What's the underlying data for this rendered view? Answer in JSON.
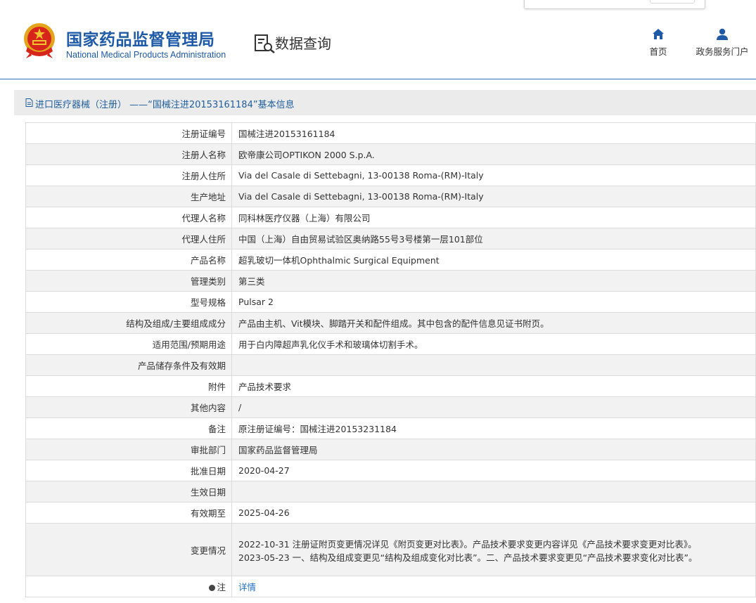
{
  "header": {
    "agency_name_cn": "国家药品监督管理局",
    "agency_name_en": "National Medical Products Administration",
    "query_title": "数据查询",
    "nav": {
      "home_label": "首页",
      "portal_label": "政务服务门户"
    }
  },
  "title_bar": {
    "text": "进口医疗器械（注册） ——“国械注进20153161184”基本信息"
  },
  "table": {
    "rows": [
      {
        "label": "注册证编号",
        "value": "国械注进20153161184"
      },
      {
        "label": "注册人名称",
        "value": "欧帝康公司OPTIKON 2000 S.p.A."
      },
      {
        "label": "注册人住所",
        "value": "Via del Casale di Settebagni, 13-00138 Roma-(RM)-Italy"
      },
      {
        "label": "生产地址",
        "value": "Via del Casale di Settebagni, 13-00138 Roma-(RM)-Italy"
      },
      {
        "label": "代理人名称",
        "value": "同科林医疗仪器（上海）有限公司"
      },
      {
        "label": "代理人住所",
        "value": "中国（上海）自由贸易试验区奥纳路55号3号楼第一层101部位"
      },
      {
        "label": "产品名称",
        "value": "超乳玻切一体机Ophthalmic Surgical Equipment"
      },
      {
        "label": "管理类别",
        "value": "第三类"
      },
      {
        "label": "型号规格",
        "value": "Pulsar 2"
      },
      {
        "label": "结构及组成/主要组成成分",
        "value": "产品由主机、Vit模块、脚踏开关和配件组成。其中包含的配件信息见证书附页。"
      },
      {
        "label": "适用范围/预期用途",
        "value": "用于白内障超声乳化仪手术和玻璃体切割手术。"
      },
      {
        "label": "产品储存条件及有效期",
        "value": ""
      },
      {
        "label": "附件",
        "value": "产品技术要求"
      },
      {
        "label": "其他内容",
        "value": "/"
      },
      {
        "label": "备注",
        "value": "原注册证编号：国械注进20153231184"
      },
      {
        "label": "审批部门",
        "value": "国家药品监督管理局"
      },
      {
        "label": "批准日期",
        "value": "2020-04-27"
      },
      {
        "label": "生效日期",
        "value": ""
      },
      {
        "label": "有效期至",
        "value": "2025-04-26"
      }
    ],
    "change": {
      "label": "变更情况",
      "line1": "2022-10-31 注册证附页变更情况详见《附页变更对比表》。产品技术要求变更内容详见《产品技术要求变更对比表》。",
      "line2": "2023-05-23 一、结构及组成变更见“结构及组成变化对比表”。二、产品技术要求变更见“产品技术要求变化对比表”。"
    },
    "note": {
      "label": "注",
      "link_text": "详情"
    }
  },
  "colors": {
    "brand_blue": "#1e5aa8",
    "title_bar_bg": "#ebebeb",
    "link_blue": "#1f6fbf",
    "header_rule": "#2f71b8"
  }
}
